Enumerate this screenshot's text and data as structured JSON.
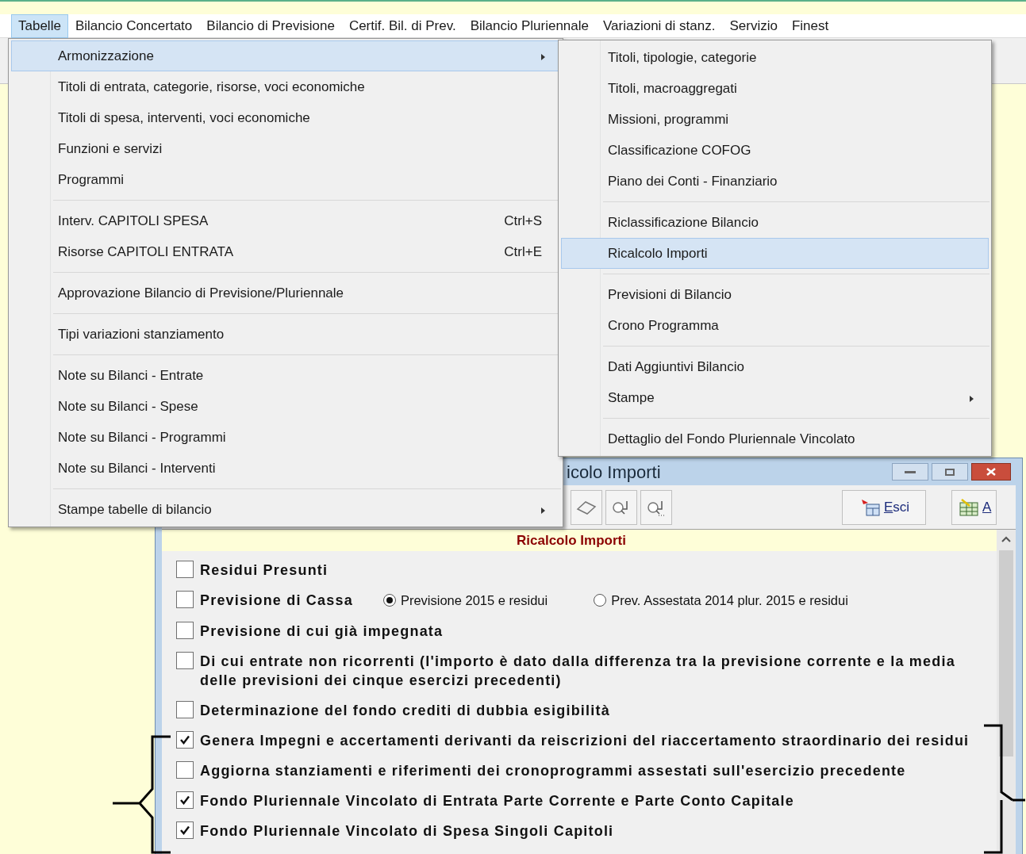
{
  "menubar": [
    {
      "label": "Tabelle",
      "selected": true
    },
    {
      "label": "Bilancio Concertato",
      "selected": false
    },
    {
      "label": "Bilancio di Previsione",
      "selected": false
    },
    {
      "label": "Certif. Bil. di Prev.",
      "selected": false
    },
    {
      "label": "Bilancio Pluriennale",
      "selected": false
    },
    {
      "label": "Variazioni di stanz.",
      "selected": false
    },
    {
      "label": "Servizio",
      "selected": false
    },
    {
      "label": "Finest",
      "selected": false
    }
  ],
  "main_menu": [
    [
      {
        "label": "Armonizzazione",
        "selected": true,
        "has_submenu": true
      },
      {
        "label": "Titoli di entrata, categorie, risorse, voci economiche",
        "selected": false,
        "has_submenu": false
      },
      {
        "label": "Titoli di spesa, interventi, voci economiche",
        "selected": false,
        "has_submenu": false
      },
      {
        "label": "Funzioni e servizi",
        "selected": false,
        "has_submenu": false
      },
      {
        "label": "Programmi",
        "selected": false,
        "has_submenu": false
      }
    ],
    [
      {
        "label": "Interv. CAPITOLI SPESA",
        "shortcut": "Ctrl+S",
        "selected": false,
        "has_submenu": false
      },
      {
        "label": "Risorse CAPITOLI ENTRATA",
        "shortcut": "Ctrl+E",
        "selected": false,
        "has_submenu": false
      }
    ],
    [
      {
        "label": "Approvazione Bilancio di  Previsione/Pluriennale",
        "selected": false,
        "has_submenu": false
      }
    ],
    [
      {
        "label": "Tipi variazioni stanziamento",
        "selected": false,
        "has_submenu": false
      }
    ],
    [
      {
        "label": "Note su Bilanci - Entrate",
        "selected": false,
        "has_submenu": false
      },
      {
        "label": "Note su Bilanci - Spese",
        "selected": false,
        "has_submenu": false
      },
      {
        "label": "Note su Bilanci - Programmi",
        "selected": false,
        "has_submenu": false
      },
      {
        "label": "Note su Bilanci - Interventi",
        "selected": false,
        "has_submenu": false
      }
    ],
    [
      {
        "label": "Stampe tabelle di bilancio",
        "selected": false,
        "has_submenu": true
      }
    ]
  ],
  "submenu": [
    [
      {
        "label": "Titoli, tipologie, categorie",
        "selected": false,
        "has_submenu": false
      },
      {
        "label": "Titoli, macroaggregati",
        "selected": false,
        "has_submenu": false
      },
      {
        "label": "Missioni, programmi",
        "selected": false,
        "has_submenu": false
      },
      {
        "label": "Classificazione COFOG",
        "selected": false,
        "has_submenu": false
      },
      {
        "label": "Piano dei Conti - Finanziario",
        "selected": false,
        "has_submenu": false
      }
    ],
    [
      {
        "label": "Riclassificazione Bilancio",
        "selected": false,
        "has_submenu": false
      },
      {
        "label": "Ricalcolo Importi",
        "selected": true,
        "has_submenu": false
      }
    ],
    [
      {
        "label": "Previsioni di Bilancio",
        "selected": false,
        "has_submenu": false
      },
      {
        "label": "Crono Programma",
        "selected": false,
        "has_submenu": false
      }
    ],
    [
      {
        "label": "Dati Aggiuntivi Bilancio",
        "selected": false,
        "has_submenu": false
      },
      {
        "label": "Stampe",
        "selected": false,
        "has_submenu": true
      }
    ],
    [
      {
        "label": "Dettaglio del Fondo Pluriennale Vincolato",
        "selected": false,
        "has_submenu": false
      }
    ]
  ],
  "dialog": {
    "title": "icolo Importi",
    "toolbar": [
      {
        "kind": "eraser"
      },
      {
        "kind": "find"
      },
      {
        "kind": "find-more"
      },
      {
        "kind": "exit",
        "label": "Esci"
      },
      {
        "kind": "table",
        "label": "A"
      }
    ],
    "header": "Ricalcolo Importi",
    "options": [
      {
        "label": "Residui Presunti",
        "checked": false
      },
      {
        "label": "Previsione di Cassa",
        "checked": false,
        "radios": [
          {
            "label": "Previsione 2015 e residui",
            "selected": true
          },
          {
            "label": "Prev. Assestata 2014 plur. 2015 e residui",
            "selected": false
          }
        ]
      },
      {
        "label": "Previsione di cui già impegnata",
        "checked": false
      },
      {
        "label": "Di cui entrate non ricorrenti (l'importo è dato dalla differenza tra la previsione corrente e la media delle previsioni dei cinque esercizi precedenti)",
        "checked": false
      },
      {
        "label": "Determinazione del fondo crediti di dubbia esigibilità",
        "checked": false
      },
      {
        "label": "Genera Impegni e accertamenti derivanti da reiscrizioni del riaccertamento straordinario dei residui",
        "checked": true
      },
      {
        "label": "Aggiorna stanziamenti e riferimenti dei cronoprogrammi assestati sull'esercizio precedente",
        "checked": false
      },
      {
        "label": "Fondo Pluriennale Vincolato di Entrata Parte Corrente e Parte Conto Capitale",
        "checked": true
      },
      {
        "label": "Fondo Pluriennale Vincolato di Spesa Singoli Capitoli",
        "checked": true
      }
    ]
  }
}
